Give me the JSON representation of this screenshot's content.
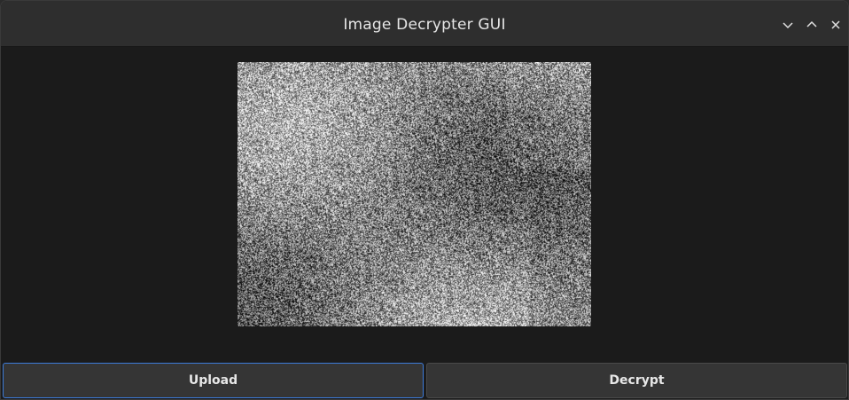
{
  "window": {
    "title": "Image Decrypter GUI",
    "controls": [
      "minimize-icon",
      "maximize-icon",
      "close-icon"
    ]
  },
  "image": {
    "description_icon": "encrypted-noise-image"
  },
  "buttons": {
    "upload_label": "Upload",
    "decrypt_label": "Decrypt"
  },
  "colors": {
    "window_bg": "#1b1b1b",
    "titlebar_bg": "#2e2e2e",
    "button_bg": "#353535",
    "focus_accent": "#3d7bd9",
    "text": "#e6e6e6"
  }
}
